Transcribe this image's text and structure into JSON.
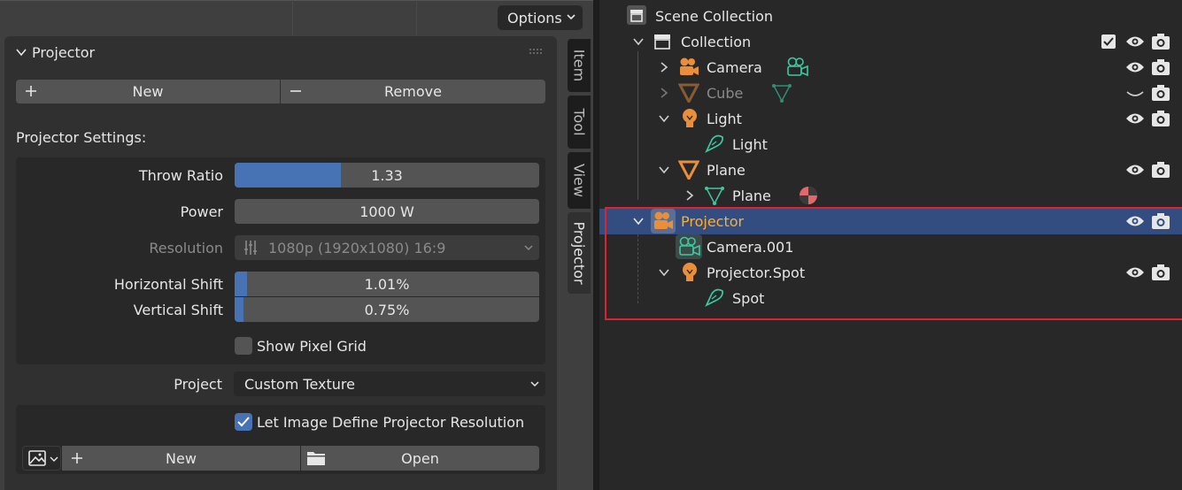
{
  "viewport": {
    "options_label": "Options"
  },
  "panel": {
    "title": "Projector",
    "new_label": "New",
    "remove_label": "Remove",
    "settings_heading": "Projector Settings:",
    "throw_ratio": {
      "label": "Throw Ratio",
      "value": "1.33",
      "fill": 0.35
    },
    "power": {
      "label": "Power",
      "value": "1000 W"
    },
    "resolution": {
      "label": "Resolution",
      "value": "1080p (1920x1080) 16:9"
    },
    "horizontal_shift": {
      "label": "Horizontal Shift",
      "value": "1.01%",
      "fill": 0.04
    },
    "vertical_shift": {
      "label": "Vertical Shift",
      "value": "0.75%",
      "fill": 0.03
    },
    "show_pixel_grid": {
      "label": "Show Pixel Grid",
      "checked": false
    },
    "project": {
      "label": "Project",
      "value": "Custom Texture"
    },
    "let_image_define": {
      "label": "Let Image Define Projector Resolution",
      "checked": true
    },
    "image_new_label": "New",
    "image_open_label": "Open"
  },
  "tabs": [
    "Item",
    "Tool",
    "View",
    "Projector"
  ],
  "outliner": {
    "scene_collection": "Scene Collection",
    "collection": "Collection",
    "camera": "Camera",
    "cube": "Cube",
    "light": "Light",
    "light_data": "Light",
    "plane": "Plane",
    "plane_mesh": "Plane",
    "projector": "Projector",
    "camera_001": "Camera.001",
    "projector_spot": "Projector.Spot",
    "spot": "Spot"
  },
  "colors": {
    "accent_blue": "#4772b3",
    "selection": "#334d80",
    "active_text": "#ffaf29",
    "object_orange": "#e98f3a",
    "data_green": "#3fc7a2",
    "highlight_red": "#e0212e"
  }
}
